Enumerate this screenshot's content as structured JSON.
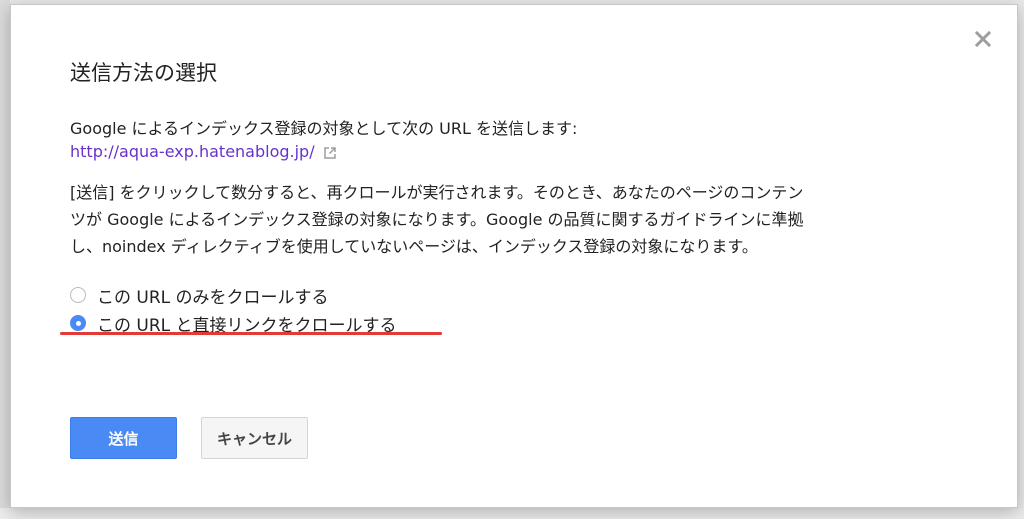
{
  "dialog": {
    "title": "送信方法の選択",
    "intro": "Google によるインデックス登録の対象として次の URL を送信します:",
    "url": "http://aqua-exp.hatenablog.jp/",
    "description_lines": [
      "[送信] をクリックして数分すると、再クロールが実行されます。そのとき、あなたのページのコンテン",
      "ツが Google によるインデックス登録の対象になります。Google の品質に関するガイドラインに準拠",
      "し、noindex ディレクティブを使用していないページは、インデックス登録の対象になります。"
    ],
    "options": [
      {
        "label": "この URL のみをクロールする",
        "selected": false
      },
      {
        "label": "この URL と直接リンクをクロールする",
        "selected": true
      }
    ],
    "submit_label": "送信",
    "cancel_label": "キャンセル"
  },
  "colors": {
    "accent": "#4a8af4",
    "link": "#6633cc",
    "highlight_underline": "#e53935"
  },
  "icons": {
    "close": "close-icon",
    "external_link": "external-link-icon"
  }
}
